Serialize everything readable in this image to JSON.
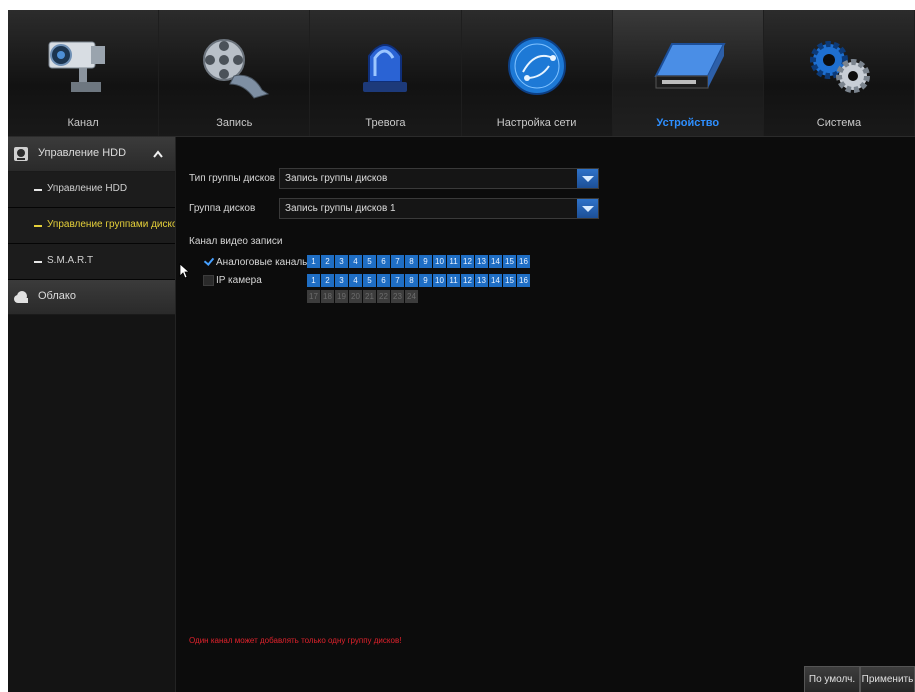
{
  "nav": {
    "tabs": [
      {
        "label": "Канал",
        "icon": "camera-icon"
      },
      {
        "label": "Запись",
        "icon": "film-reel-icon"
      },
      {
        "label": "Тревога",
        "icon": "alarm-siren-icon"
      },
      {
        "label": "Настройка сети",
        "icon": "network-globe-icon"
      },
      {
        "label": "Устройство",
        "icon": "hard-drive-icon",
        "active": true
      },
      {
        "label": "Система",
        "icon": "gears-icon"
      }
    ]
  },
  "sidebar": {
    "hdd_header": "Управление HDD",
    "items": [
      {
        "label": "Управление HDD"
      },
      {
        "label": "Управление группами дисков",
        "selected": true
      },
      {
        "label": "S.M.A.R.T"
      }
    ],
    "cloud_header": "Облако"
  },
  "form": {
    "group_type_label": "Тип группы дисков",
    "group_type_value": "Запись группы дисков",
    "disk_group_label": "Группа дисков",
    "disk_group_value": "Запись группы дисков 1",
    "channel_section_label": "Канал видео записи",
    "analog_label": "Аналоговые каналы",
    "ip_label": "IP камера",
    "analog_channels": [
      "1",
      "2",
      "3",
      "4",
      "5",
      "6",
      "7",
      "8",
      "9",
      "10",
      "11",
      "12",
      "13",
      "14",
      "15",
      "16"
    ],
    "ip_channels_row1": [
      "1",
      "2",
      "3",
      "4",
      "5",
      "6",
      "7",
      "8",
      "9",
      "10",
      "11",
      "12",
      "13",
      "14",
      "15",
      "16"
    ],
    "ip_channels_row2": [
      "17",
      "18",
      "19",
      "20",
      "21",
      "22",
      "23",
      "24"
    ],
    "warning": "Один канал может добавлять только одну группу дисков!"
  },
  "buttons": {
    "default": "По умолч.",
    "apply": "Применить"
  },
  "colors": {
    "accent": "#1f6ec4",
    "active_tab": "#2e8fff",
    "selected_item": "#e6d13a",
    "warning": "#e1222c"
  }
}
